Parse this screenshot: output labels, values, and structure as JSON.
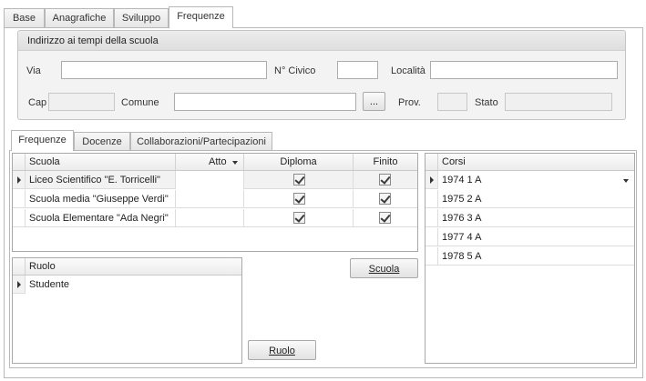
{
  "top_tabs": [
    {
      "label": "Base"
    },
    {
      "label": "Anagrafiche"
    },
    {
      "label": "Sviluppo"
    },
    {
      "label": "Frequenze"
    }
  ],
  "address": {
    "title": "Indirizzo ai tempi della scuola",
    "via_label": "Via",
    "civico_label": "N° Civico",
    "localita_label": "Località",
    "cap_label": "Cap",
    "comune_label": "Comune",
    "browse_label": "...",
    "prov_label": "Prov.",
    "stato_label": "Stato",
    "via_value": "",
    "civico_value": "",
    "localita_value": "",
    "cap_value": "",
    "comune_value": "",
    "prov_value": "",
    "stato_value": ""
  },
  "inner_tabs": [
    {
      "label": "Frequenze"
    },
    {
      "label": "Docenze"
    },
    {
      "label": "Collaborazioni/Partecipazioni"
    }
  ],
  "schools_grid": {
    "columns": [
      "Scuola",
      "Atto",
      "Diploma",
      "Finito"
    ],
    "rows": [
      {
        "scuola": "Liceo Scientifico \"E. Torricelli\"",
        "atto": "",
        "diploma": true,
        "finito": true
      },
      {
        "scuola": "Scuola media \"Giuseppe Verdi\"",
        "atto": "",
        "diploma": true,
        "finito": true
      },
      {
        "scuola": "Scuola Elementare \"Ada Negri\"",
        "atto": "",
        "diploma": true,
        "finito": true
      }
    ]
  },
  "courses_grid": {
    "header": "Corsi",
    "rows": [
      "1974 1 A",
      "1975 2 A",
      "1976 3 A",
      "1977 4 A",
      "1978 5 A"
    ]
  },
  "roles_grid": {
    "header": "Ruolo",
    "rows": [
      "Studente"
    ]
  },
  "buttons": {
    "scuola_label": "Scuola",
    "ruolo_label": "Ruolo"
  }
}
